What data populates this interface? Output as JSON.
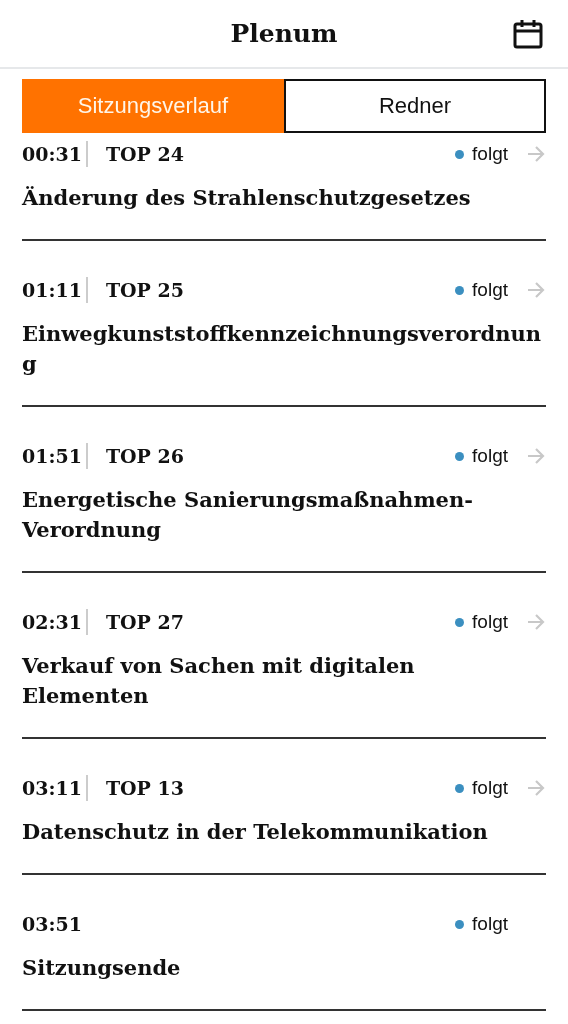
{
  "header": {
    "title": "Plenum"
  },
  "tabs": [
    {
      "label": "Sitzungsverlauf",
      "selected": true
    },
    {
      "label": "Redner",
      "selected": false
    }
  ],
  "agenda": [
    {
      "time": "00:31",
      "top": "TOP 24",
      "status": "folgt",
      "color": "#3b8fc0",
      "title": "Änderung des Strahlenschutzgesetzes",
      "linked": true
    },
    {
      "time": "01:11",
      "top": "TOP 25",
      "status": "folgt",
      "color": "#3b8fc0",
      "title": "Einwegkunststoffkennzeichnungsverordnung",
      "linked": true
    },
    {
      "time": "01:51",
      "top": "TOP 26",
      "status": "folgt",
      "color": "#3b8fc0",
      "title": "Energetische Sanierungsmaßnahmen-Verordnung",
      "linked": true
    },
    {
      "time": "02:31",
      "top": "TOP 27",
      "status": "folgt",
      "color": "#3b8fc0",
      "title": "Verkauf von Sachen mit digitalen Elementen",
      "linked": true
    },
    {
      "time": "03:11",
      "top": "TOP 13",
      "status": "folgt",
      "color": "#3b8fc0",
      "title": "Datenschutz in der Telekommunikation",
      "linked": true
    },
    {
      "time": "03:51",
      "status": "folgt",
      "color": "#3b8fc0",
      "title": "Sitzungsende",
      "linked": false
    }
  ]
}
